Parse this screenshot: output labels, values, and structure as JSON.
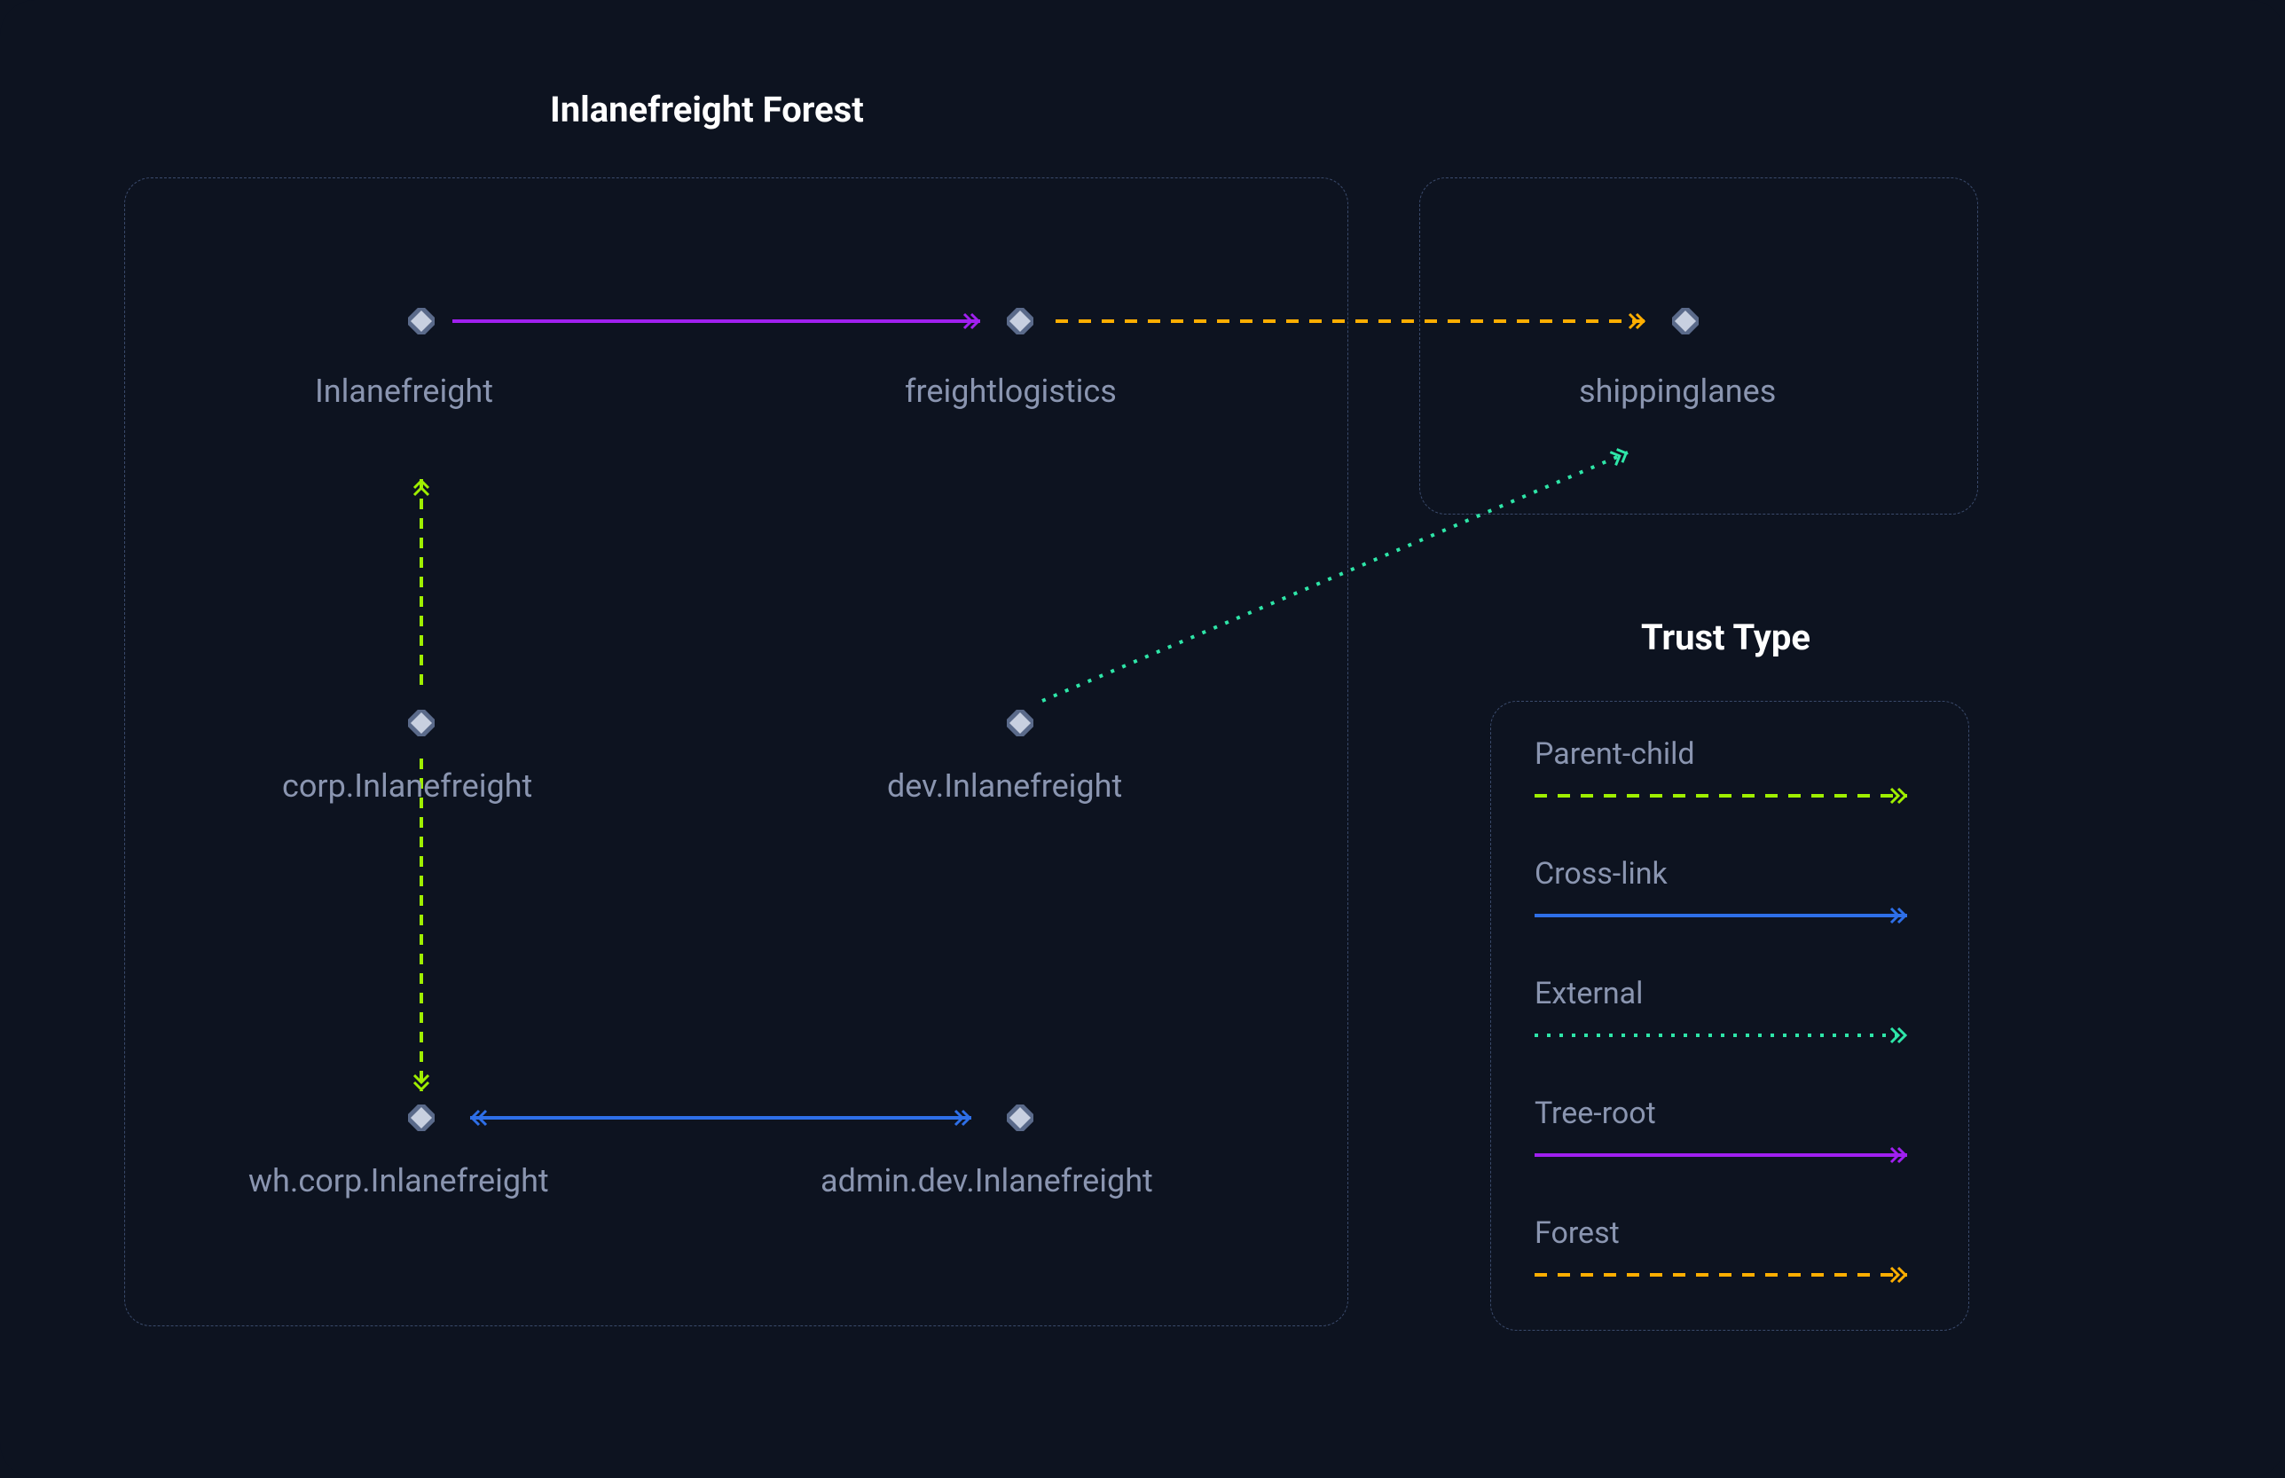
{
  "title": "Inlanefreight Forest",
  "legend_title": "Trust Type",
  "nodes": {
    "inlanefreight": "Inlanefreight",
    "freightlogistics": "freightlogistics",
    "shippinglanes": "shippinglanes",
    "corp": "corp.Inlanefreight",
    "dev": "dev.Inlanefreight",
    "wh": "wh.corp.Inlanefreight",
    "admin": "admin.dev.Inlanefreight"
  },
  "legend": {
    "parent_child": "Parent-child",
    "cross_link": "Cross-link",
    "external": "External",
    "tree_root": "Tree-root",
    "forest": "Forest"
  },
  "colors": {
    "bg": "#0d1320",
    "text_muted": "#8a95b0",
    "text_white": "#ffffff",
    "node_fill": "#c8d0e0",
    "node_stroke": "#5a6a8a",
    "parent_child": "#9fef00",
    "cross_link": "#2e6fe8",
    "external": "#2ee6a8",
    "tree_root": "#a020f0",
    "forest": "#ffae00"
  }
}
